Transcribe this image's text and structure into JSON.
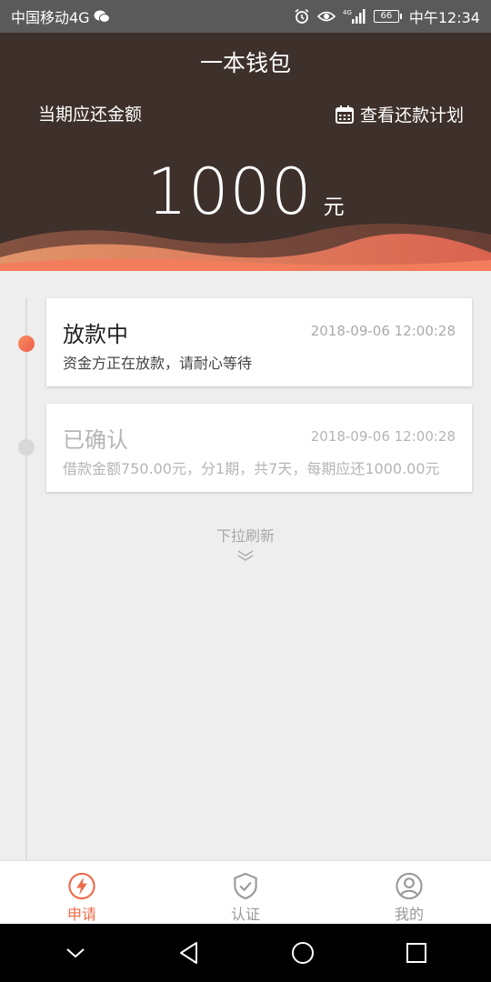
{
  "status_bar": {
    "carrier": "中国移动4G",
    "time": "中午12:34",
    "battery": "66",
    "network": "4G"
  },
  "header": {
    "app_title": "一本钱包",
    "due_label": "当期应还金额",
    "plan_link": "查看还款计划",
    "amount": "1000",
    "amount_unit": "元",
    "colors": {
      "background": "#3e302b",
      "wave_accent": "#ef6b4a"
    }
  },
  "timeline": {
    "items": [
      {
        "title": "放款中",
        "time": "2018-09-06 12:00:28",
        "desc": "资金方正在放款，请耐心等待",
        "active": true
      },
      {
        "title": "已确认",
        "time": "2018-09-06 12:00:28",
        "desc": "借款金额750.00元，分1期，共7天，每期应还1000.00元",
        "active": false
      }
    ],
    "pull_refresh": "下拉刷新"
  },
  "tabbar": {
    "items": [
      {
        "label": "申请",
        "icon": "lightning-icon",
        "active": true
      },
      {
        "label": "认证",
        "icon": "shield-check-icon",
        "active": false
      },
      {
        "label": "我的",
        "icon": "user-icon",
        "active": false
      }
    ]
  },
  "navbar": {
    "buttons": [
      "chevron-down-icon",
      "back-icon",
      "home-icon",
      "recents-icon"
    ]
  }
}
